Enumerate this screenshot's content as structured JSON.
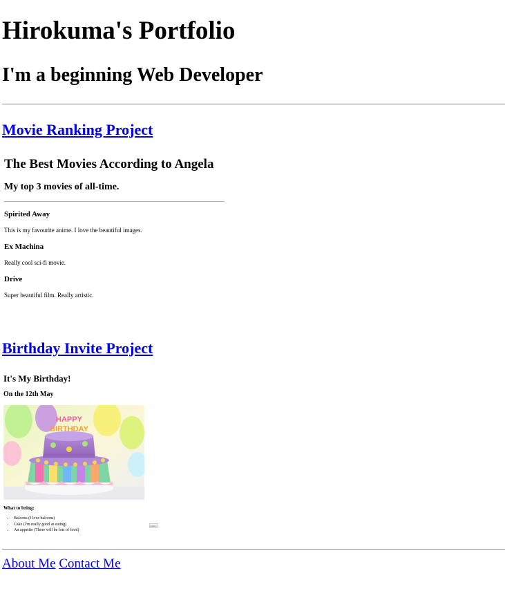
{
  "header": {
    "title": "Hirokuma's Portfolio",
    "subtitle": "I'm a beginning Web Developer"
  },
  "projects": [
    {
      "link_label": "Movie Ranking Project",
      "preview": {
        "title": "The Best Movies According to Angela",
        "subtitle": "My top 3 movies of all-time.",
        "movies": [
          {
            "name": "Spirited Away",
            "description": "This is my favourite anime. I love the beautiful images."
          },
          {
            "name": "Ex Machina",
            "description": "Really cool sci-fi movie."
          },
          {
            "name": "Drive",
            "description": "Super beautiful film. Really artistic."
          }
        ]
      }
    },
    {
      "link_label": "Birthday Invite Project",
      "preview": {
        "title": "It's My Birthday!",
        "date": "On the 12th May",
        "image_text": "HAPPY BIRTHDAY",
        "bring_heading": "What to bring:",
        "items": [
          "Baloons (I love baloons)",
          "Cake (I'm really good at eating)",
          "An appetite (There will be lots of food)"
        ],
        "button_label": "Gallery"
      }
    }
  ],
  "footer": {
    "about_label": "About Me",
    "contact_label": "Contact Me"
  },
  "colors": {
    "link": "#0000ee",
    "rule": "#9a9a9a"
  }
}
